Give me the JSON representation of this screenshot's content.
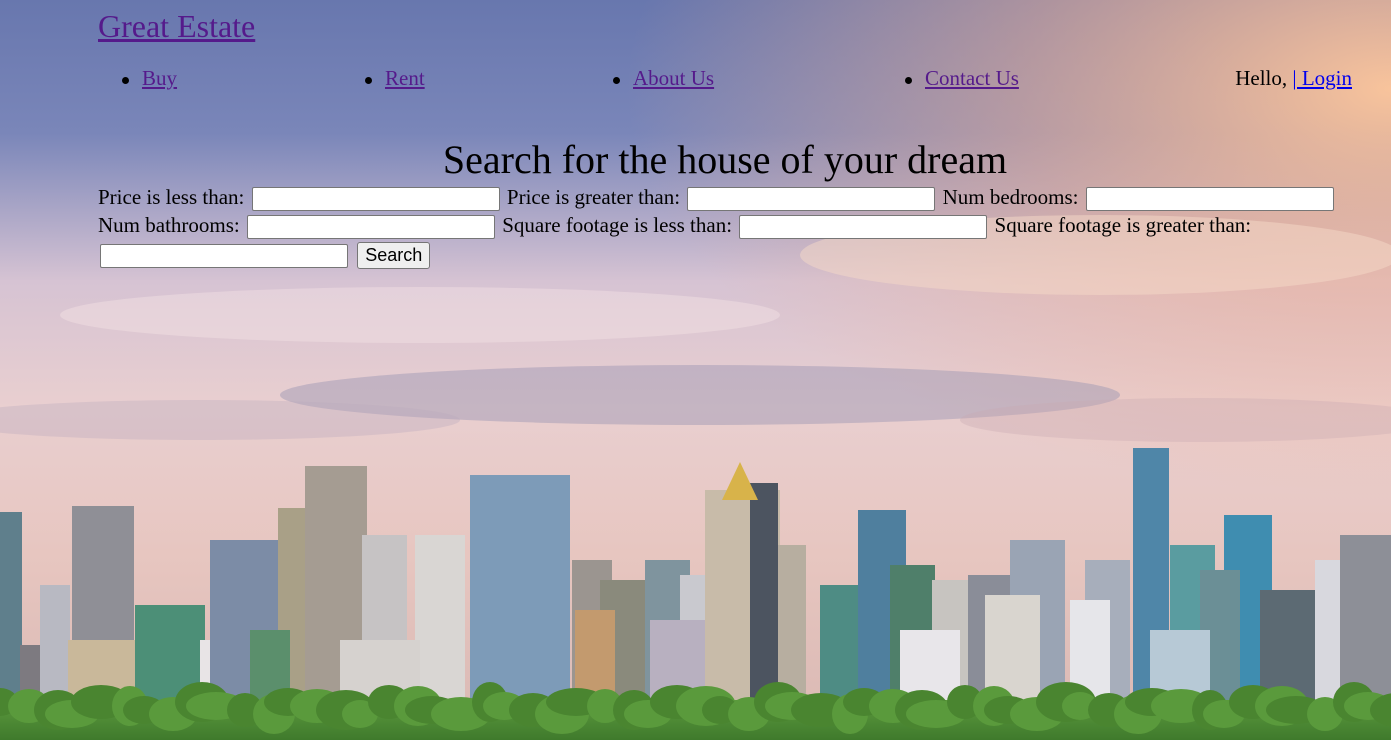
{
  "site": {
    "brand": "Great Estate"
  },
  "nav": {
    "items": [
      "Buy",
      "Rent",
      "About Us",
      "Contact Us"
    ],
    "greeting": "Hello,",
    "login": "| Login"
  },
  "hero": {
    "title": "Search for the house of your dream"
  },
  "search": {
    "fields": [
      {
        "label": "Price is less than:",
        "value": ""
      },
      {
        "label": "Price is greater than:",
        "value": ""
      },
      {
        "label": "Num bedrooms:",
        "value": ""
      },
      {
        "label": "Num bathrooms:",
        "value": ""
      },
      {
        "label": "Square footage is less than:",
        "value": ""
      },
      {
        "label": "Square footage is greater than:",
        "value": ""
      }
    ],
    "button": "Search"
  },
  "background": {
    "subject": "city-skyline-at-sunset",
    "colors": {
      "sky_top": "#6f80b6",
      "sky_glow": "#f0b28f",
      "clouds": "#e4cbd5",
      "trees": "#4c8a37"
    }
  }
}
